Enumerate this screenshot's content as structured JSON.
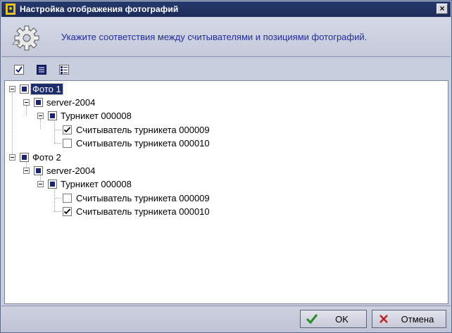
{
  "window": {
    "title": "Настройка отображения фотографий",
    "close_label": "×"
  },
  "header": {
    "instruction": "Укажите соответствия между считывателями и позициями фотографий."
  },
  "toolbar": {
    "icons": [
      "check-all-icon",
      "list-icon",
      "tree-view-icon"
    ]
  },
  "tree": {
    "photo1": {
      "label": "Фото 1",
      "server": "server-2004",
      "turnstile": "Турникет  000008",
      "readers": [
        {
          "label": "Считыватель турникета 000009",
          "checked": true
        },
        {
          "label": "Считыватель турникета 000010",
          "checked": false
        }
      ]
    },
    "photo2": {
      "label": "Фото 2",
      "server": "server-2004",
      "turnstile": "Турникет  000008",
      "readers": [
        {
          "label": "Считыватель турникета 000009",
          "checked": false
        },
        {
          "label": "Считыватель турникета 000010",
          "checked": true
        }
      ]
    }
  },
  "footer": {
    "ok_label": "OK",
    "cancel_label": "Отмена"
  },
  "colors": {
    "title_bar": "#1c2c5a",
    "accent_text": "#222c9a",
    "selection": "#1d2c6a",
    "ok_check": "#2a8a2a",
    "cancel_x": "#c02020"
  }
}
